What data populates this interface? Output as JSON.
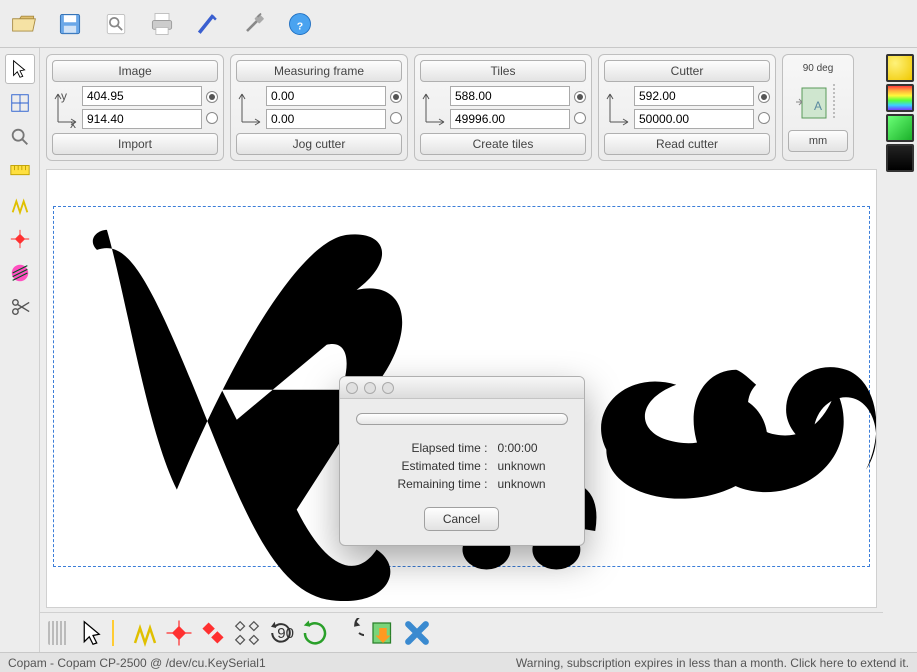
{
  "toolbar": {
    "open_label": "Open",
    "save_label": "Save",
    "search_label": "Search",
    "print_label": "Print",
    "pen_label": "Pen",
    "settings_label": "Settings",
    "help_label": "Help"
  },
  "panels": {
    "image": {
      "title": "Image",
      "x": "404.95",
      "y": "914.40",
      "button": "Import"
    },
    "frame": {
      "title": "Measuring frame",
      "x": "0.00",
      "y": "0.00",
      "button": "Jog cutter"
    },
    "tiles": {
      "title": "Tiles",
      "x": "588.00",
      "y": "49996.00",
      "button": "Create tiles"
    },
    "cutter": {
      "title": "Cutter",
      "x": "592.00",
      "y": "50000.00",
      "button": "Read cutter"
    },
    "rotation": {
      "angle_label": "90 deg",
      "unit": "mm"
    }
  },
  "left_tools": [
    "pointer",
    "grid",
    "zoom",
    "ruler",
    "weed",
    "registration",
    "hatch",
    "scissors"
  ],
  "bottom_tools": [
    "pointer",
    "weed",
    "registration",
    "registration-multi",
    "nodes",
    "rotate-90",
    "reload",
    "undo",
    "export",
    "cancel"
  ],
  "right_palette": [
    "yellow-circle",
    "rainbow",
    "green-stack",
    "black"
  ],
  "canvas": {
    "artwork_text": "A::sou"
  },
  "dialog": {
    "elapsed_label": "Elapsed time :",
    "elapsed_value": "0:00:00",
    "estimated_label": "Estimated time :",
    "estimated_value": "unknown",
    "remaining_label": "Remaining time :",
    "remaining_value": "unknown",
    "cancel": "Cancel"
  },
  "status": {
    "left": "Copam - Copam CP-2500 @ /dev/cu.KeySerial1",
    "right": "Warning, subscription expires in less than a month. Click here to extend it."
  }
}
